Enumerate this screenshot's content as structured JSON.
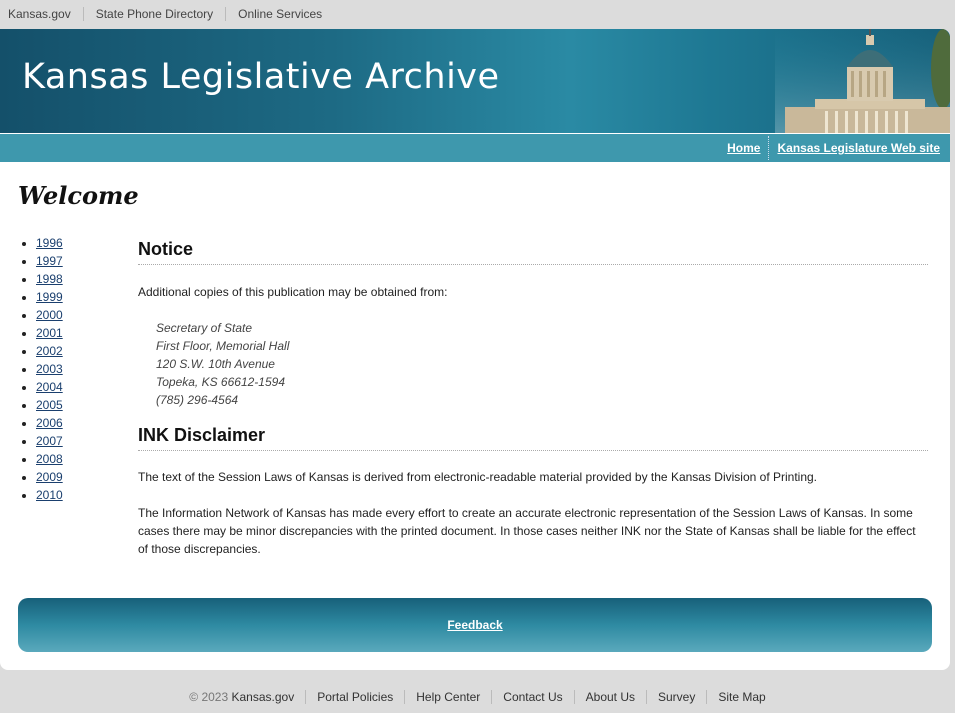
{
  "topbar": {
    "links": [
      "Kansas.gov",
      "State Phone Directory",
      "Online Services"
    ]
  },
  "banner": {
    "title": "Kansas Legislative Archive"
  },
  "nav": {
    "home": "Home",
    "legislature": "Kansas Legislature Web site"
  },
  "welcome": "Welcome",
  "years": [
    "1996",
    "1997",
    "1998",
    "1999",
    "2000",
    "2001",
    "2002",
    "2003",
    "2004",
    "2005",
    "2006",
    "2007",
    "2008",
    "2009",
    "2010"
  ],
  "notice": {
    "heading": "Notice",
    "intro": "Additional copies of this publication may be obtained from:",
    "address": [
      "Secretary of State",
      "First Floor, Memorial Hall",
      "120 S.W. 10th Avenue",
      "Topeka, KS 66612-1594",
      "(785) 296-4564"
    ]
  },
  "disclaimer": {
    "heading": "INK Disclaimer",
    "p1": "The text of the Session Laws of Kansas is derived from electronic-readable material provided by the Kansas Division of Printing.",
    "p2": "The Information Network of Kansas has made every effort to create an accurate electronic representation of the Session Laws of Kansas. In some cases there may be minor discrepancies with the printed document. In those cases neither INK nor the State of Kansas shall be liable for the effect of those discrepancies."
  },
  "feedback": "Feedback",
  "footer": {
    "copyright": "© 2023",
    "brand": "Kansas.gov",
    "links": [
      "Portal Policies",
      "Help Center",
      "Contact Us",
      "About Us",
      "Survey",
      "Site Map"
    ]
  },
  "colors": {
    "banner": "#1d6a84",
    "navstrip": "#3e98ad",
    "link": "#1a3f6e"
  }
}
